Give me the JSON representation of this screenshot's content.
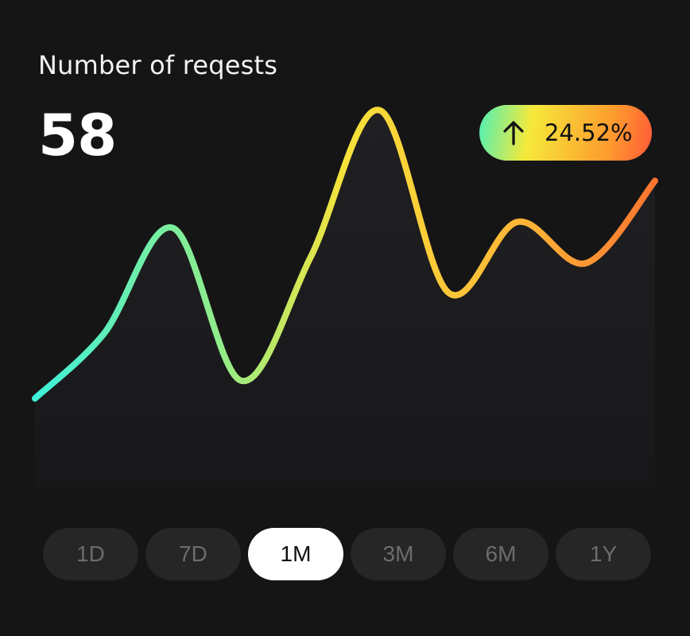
{
  "card": {
    "title": "Number of reqests",
    "value": "58",
    "change": {
      "text": "24.52%",
      "direction": "up",
      "icon": "arrow-up-icon",
      "gradient": [
        "#4ef0b7",
        "#f6e93a",
        "#fd9b2e",
        "#ff5a36"
      ]
    }
  },
  "ranges": [
    {
      "label": "1D",
      "active": false
    },
    {
      "label": "7D",
      "active": false
    },
    {
      "label": "1M",
      "active": true
    },
    {
      "label": "3M",
      "active": false
    },
    {
      "label": "6M",
      "active": false
    },
    {
      "label": "1Y",
      "active": false
    }
  ],
  "chart_data": {
    "type": "area",
    "values": [
      1.2,
      2.3,
      4.1,
      1.5,
      3.6,
      6.1,
      3.0,
      4.2,
      3.5,
      4.9
    ],
    "ylim": [
      0,
      7
    ],
    "grid": false,
    "line_gradient": [
      "#3ff0d8",
      "#92ec88",
      "#f7e23a",
      "#fdb236",
      "#fb7430"
    ],
    "fill_color": "#1f1f21"
  }
}
